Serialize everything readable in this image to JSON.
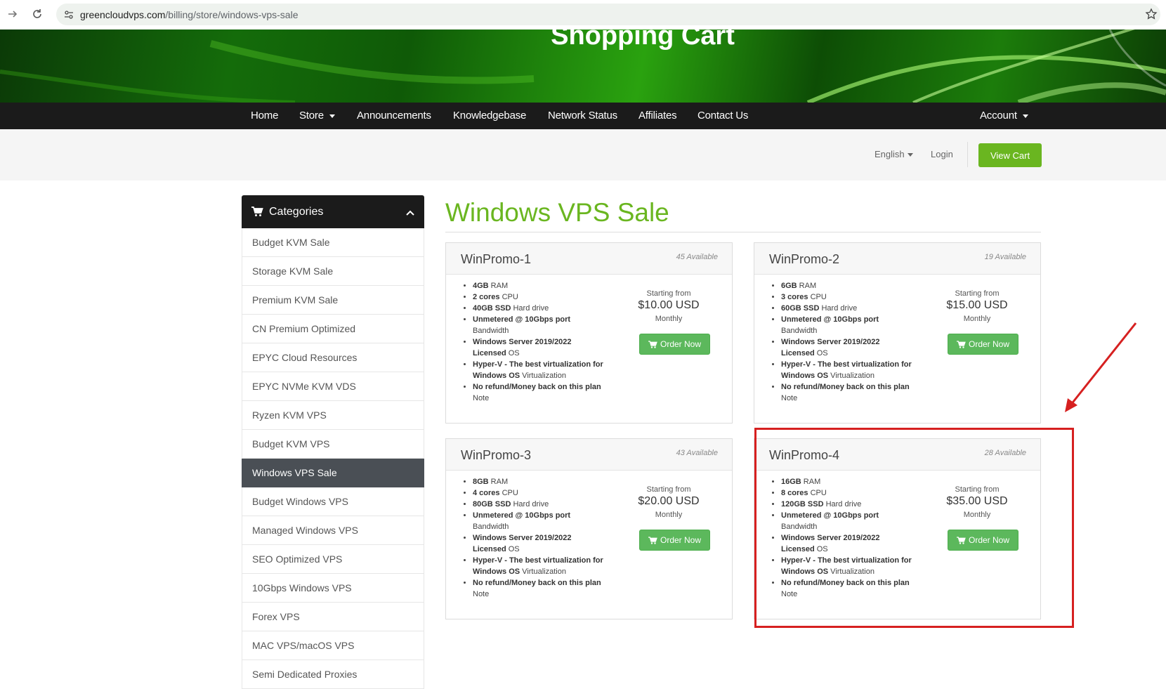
{
  "browser": {
    "url_host": "greencloudvps.com",
    "url_path": "/billing/store/windows-vps-sale"
  },
  "banner": {
    "title": "Shopping Cart"
  },
  "nav": {
    "items": [
      {
        "label": "Home"
      },
      {
        "label": "Store"
      },
      {
        "label": "Announcements"
      },
      {
        "label": "Knowledgebase"
      },
      {
        "label": "Network Status"
      },
      {
        "label": "Affiliates"
      },
      {
        "label": "Contact Us"
      }
    ],
    "account_label": "Account"
  },
  "subheader": {
    "language": "English",
    "login": "Login",
    "view_cart": "View Cart"
  },
  "sidebar": {
    "header": "Categories",
    "items": [
      {
        "label": "Budget KVM Sale"
      },
      {
        "label": "Storage KVM Sale"
      },
      {
        "label": "Premium KVM Sale"
      },
      {
        "label": "CN Premium Optimized"
      },
      {
        "label": "EPYC Cloud Resources"
      },
      {
        "label": "EPYC NVMe KVM VDS"
      },
      {
        "label": "Ryzen KVM VPS"
      },
      {
        "label": "Budget KVM VPS"
      },
      {
        "label": "Windows VPS Sale"
      },
      {
        "label": "Budget Windows VPS"
      },
      {
        "label": "Managed Windows VPS"
      },
      {
        "label": "SEO Optimized VPS"
      },
      {
        "label": "10Gbps Windows VPS"
      },
      {
        "label": "Forex VPS"
      },
      {
        "label": "MAC VPS/macOS VPS"
      },
      {
        "label": "Semi Dedicated Proxies"
      }
    ]
  },
  "main": {
    "title": "Windows VPS Sale",
    "products": [
      {
        "name": "WinPromo-1",
        "available": "45 Available",
        "f1_b": "4GB",
        "f1_t": " RAM",
        "f2_b": "2 cores",
        "f2_t": " CPU",
        "f3_b": "40GB SSD",
        "f3_t": " Hard drive",
        "f4_b": "Unmetered @ 10Gbps port",
        "f4_t": " Bandwidth",
        "f5_b": "Windows Server 2019/2022 Licensed",
        "f5_t": " OS",
        "f6_b": "Hyper-V - The best virtualization for Windows OS",
        "f6_t": " Virtualization",
        "f7_b": "No refund/Money back on this plan",
        "f7_t": " Note",
        "starting": "Starting from",
        "price": "$10.00 USD",
        "cycle": "Monthly",
        "order": "Order Now"
      },
      {
        "name": "WinPromo-2",
        "available": "19 Available",
        "f1_b": "6GB",
        "f1_t": " RAM",
        "f2_b": "3 cores",
        "f2_t": " CPU",
        "f3_b": "60GB SSD",
        "f3_t": " Hard drive",
        "f4_b": "Unmetered @ 10Gbps port",
        "f4_t": " Bandwidth",
        "f5_b": "Windows Server 2019/2022 Licensed",
        "f5_t": " OS",
        "f6_b": "Hyper-V - The best virtualization for Windows OS",
        "f6_t": " Virtualization",
        "f7_b": "No refund/Money back on this plan",
        "f7_t": " Note",
        "starting": "Starting from",
        "price": "$15.00 USD",
        "cycle": "Monthly",
        "order": "Order Now"
      },
      {
        "name": "WinPromo-3",
        "available": "43 Available",
        "f1_b": "8GB",
        "f1_t": " RAM",
        "f2_b": "4 cores",
        "f2_t": " CPU",
        "f3_b": "80GB SSD",
        "f3_t": " Hard drive",
        "f4_b": "Unmetered @ 10Gbps port",
        "f4_t": " Bandwidth",
        "f5_b": "Windows Server 2019/2022 Licensed",
        "f5_t": " OS",
        "f6_b": "Hyper-V - The best virtualization for Windows OS",
        "f6_t": " Virtualization",
        "f7_b": "No refund/Money back on this plan",
        "f7_t": " Note",
        "starting": "Starting from",
        "price": "$20.00 USD",
        "cycle": "Monthly",
        "order": "Order Now"
      },
      {
        "name": "WinPromo-4",
        "available": "28 Available",
        "f1_b": "16GB",
        "f1_t": " RAM",
        "f2_b": "8 cores",
        "f2_t": " CPU",
        "f3_b": "120GB SSD",
        "f3_t": " Hard drive",
        "f4_b": "Unmetered @ 10Gbps port",
        "f4_t": " Bandwidth",
        "f5_b": "Windows Server 2019/2022 Licensed",
        "f5_t": " OS",
        "f6_b": "Hyper-V - The best virtualization for Windows OS",
        "f6_t": " Virtualization",
        "f7_b": "No refund/Money back on this plan",
        "f7_t": " Note",
        "starting": "Starting from",
        "price": "$35.00 USD",
        "cycle": "Monthly",
        "order": "Order Now"
      }
    ]
  },
  "colors": {
    "brand_green": "#6ab620",
    "order_green": "#5cb85c",
    "nav_bg": "#1b1b1b",
    "annotation_red": "#d62020"
  }
}
